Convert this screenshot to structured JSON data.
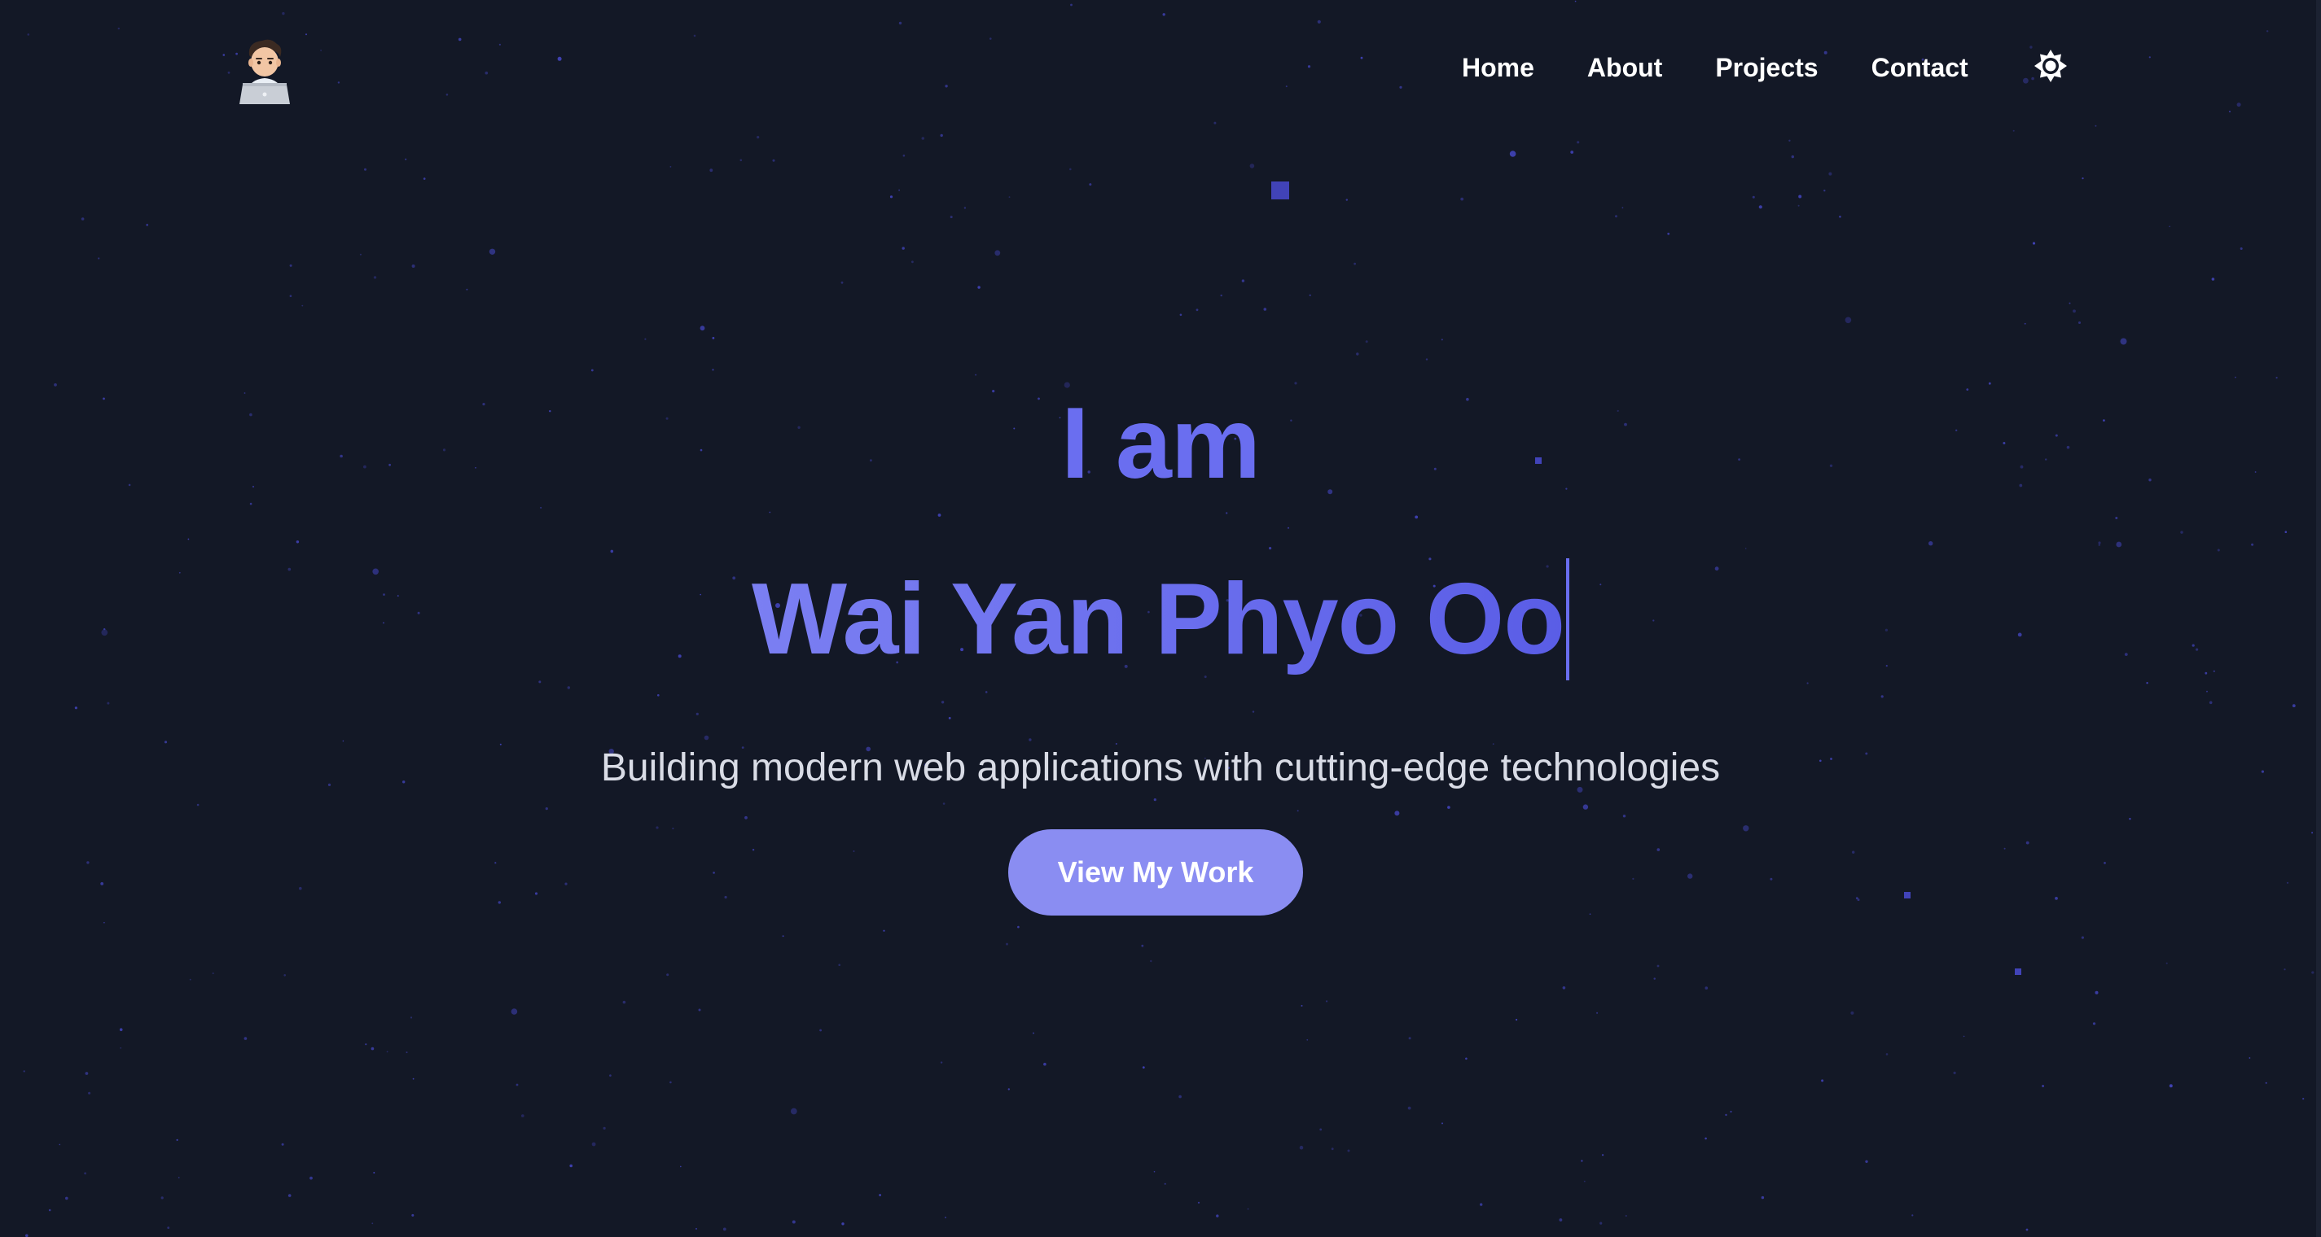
{
  "nav": {
    "logo_icon": "memoji-laptop-avatar-icon",
    "links": [
      {
        "label": "Home"
      },
      {
        "label": "About"
      },
      {
        "label": "Projects"
      },
      {
        "label": "Contact"
      }
    ],
    "theme_toggle_icon": "sun-icon"
  },
  "hero": {
    "intro": "I am",
    "name": "Wai Yan Phyo Oo",
    "subtitle": "Building modern web applications with cutting-edge technologies",
    "cta_label": "View My Work"
  },
  "colors": {
    "background": "#131826",
    "accent": "#6a6ef0",
    "button": "#8a8df2",
    "star": "#4143b8",
    "subtitle": "#d9dce6"
  }
}
